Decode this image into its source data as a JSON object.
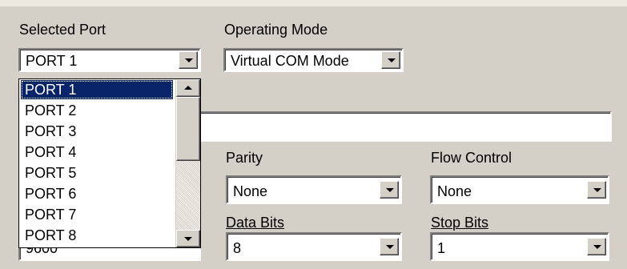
{
  "port": {
    "label": "Selected Port",
    "value": "PORT 1",
    "options": [
      "PORT 1",
      "PORT 2",
      "PORT 3",
      "PORT 4",
      "PORT 5",
      "PORT 6",
      "PORT 7",
      "PORT 8"
    ],
    "selected_index": 0
  },
  "mode": {
    "label": "Operating Mode",
    "value": "Virtual COM Mode"
  },
  "parity": {
    "label": "Parity",
    "value": "None"
  },
  "flow": {
    "label": "Flow Control",
    "value": "None"
  },
  "databits": {
    "label": "Data Bits",
    "value": "8"
  },
  "stopbits": {
    "label": "Stop Bits",
    "value": "1"
  },
  "baud": {
    "partial_value": "9600"
  },
  "colors": {
    "selection": "#0a246a",
    "panel": "#d4d0c8"
  },
  "scrollbar": {
    "position": 0.0
  }
}
